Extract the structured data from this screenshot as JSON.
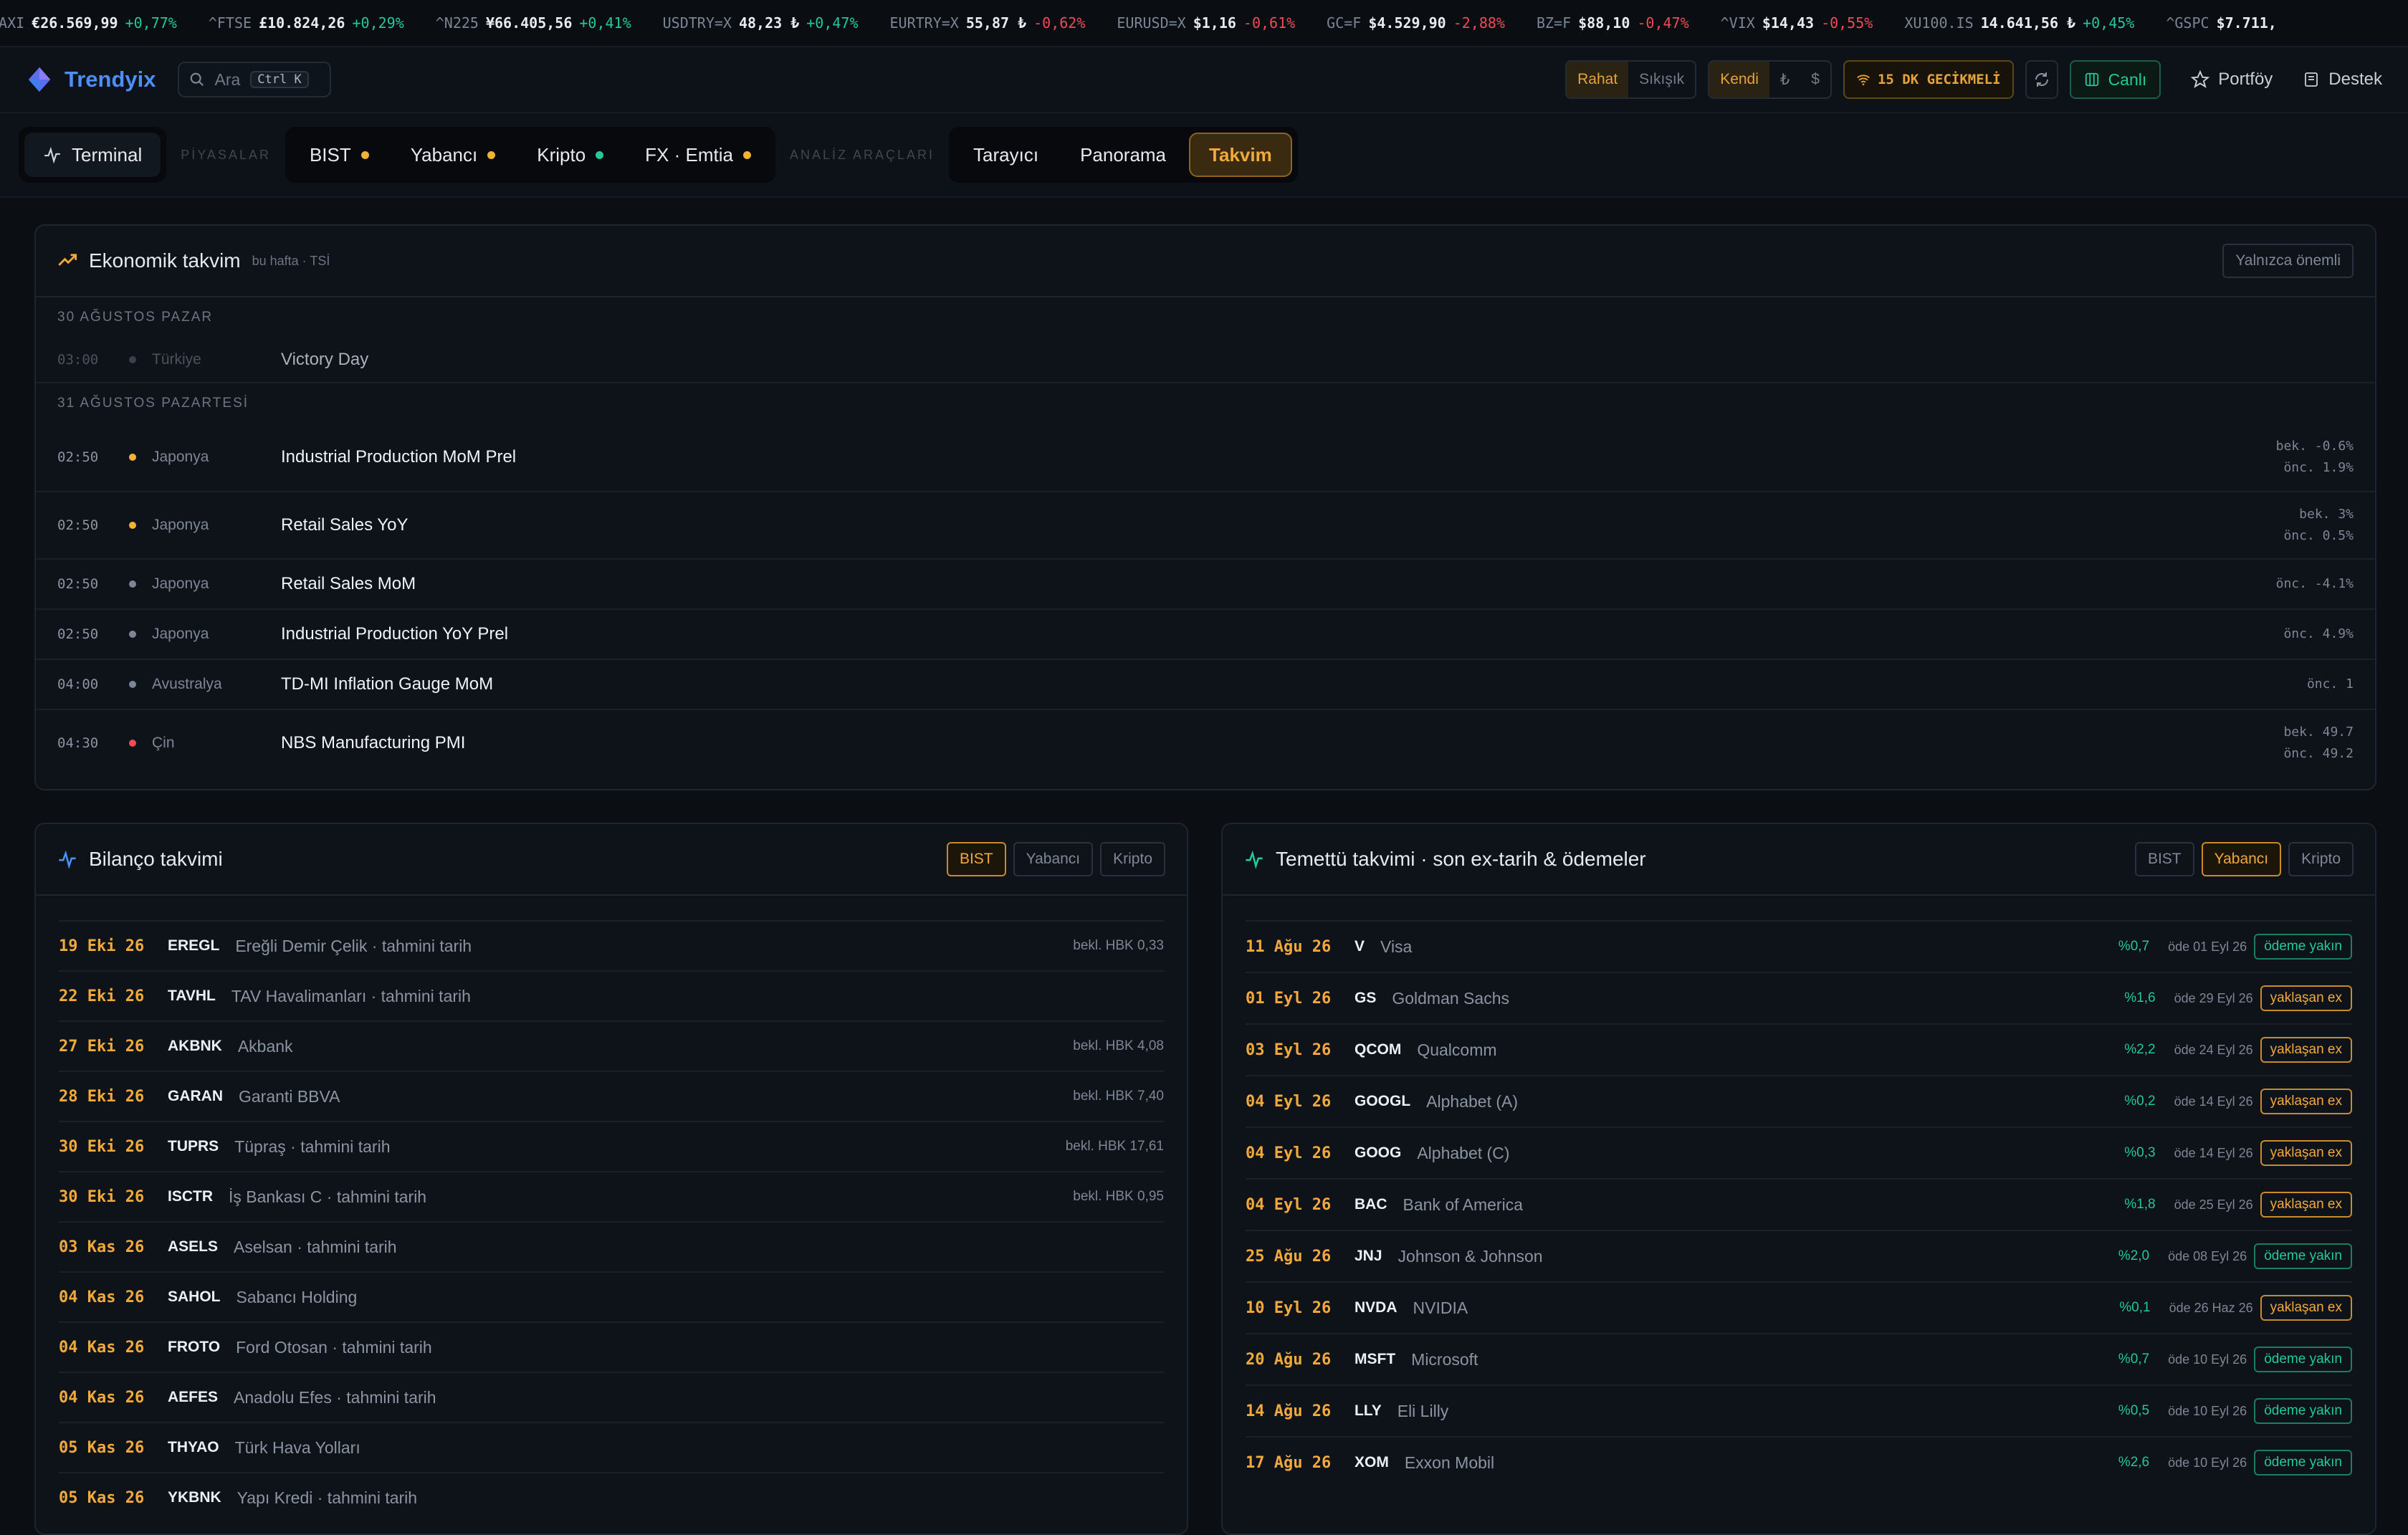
{
  "ticker": [
    {
      "sym": "DAXI",
      "price": "€26.569,99",
      "chg": "+0,77%",
      "dir": "up"
    },
    {
      "sym": "^FTSE",
      "price": "£10.824,26",
      "chg": "+0,29%",
      "dir": "up"
    },
    {
      "sym": "^N225",
      "price": "¥66.405,56",
      "chg": "+0,41%",
      "dir": "up"
    },
    {
      "sym": "USDTRY=X",
      "price": "48,23 ₺",
      "chg": "+0,47%",
      "dir": "up"
    },
    {
      "sym": "EURTRY=X",
      "price": "55,87 ₺",
      "chg": "-0,62%",
      "dir": "down"
    },
    {
      "sym": "EURUSD=X",
      "price": "$1,16",
      "chg": "-0,61%",
      "dir": "down"
    },
    {
      "sym": "GC=F",
      "price": "$4.529,90",
      "chg": "-2,88%",
      "dir": "down"
    },
    {
      "sym": "BZ=F",
      "price": "$88,10",
      "chg": "-0,47%",
      "dir": "down"
    },
    {
      "sym": "^VIX",
      "price": "$14,43",
      "chg": "-0,55%",
      "dir": "down"
    },
    {
      "sym": "XU100.IS",
      "price": "14.641,56 ₺",
      "chg": "+0,45%",
      "dir": "up"
    },
    {
      "sym": "^GSPC",
      "price": "$7.711,",
      "chg": "",
      "dir": "up"
    }
  ],
  "header": {
    "app_name": "Trendyix",
    "search_placeholder": "Ara",
    "search_shortcut": "Ctrl K",
    "density": [
      "Rahat",
      "Sıkışık"
    ],
    "currency": [
      "Kendi",
      "₺",
      "$"
    ],
    "delay_label": "15 DK GECİKMELİ",
    "live_label": "Canlı",
    "portfolio_label": "Portföy",
    "support_label": "Destek"
  },
  "nav": {
    "terminal": "Terminal",
    "markets_label": "PİYASALAR",
    "markets": [
      {
        "label": "BIST",
        "dot": "#f2b233"
      },
      {
        "label": "Yabancı",
        "dot": "#f2b233"
      },
      {
        "label": "Kripto",
        "dot": "#22c99a"
      },
      {
        "label": "FX · Emtia",
        "dot": "#f2b233"
      }
    ],
    "tools_label": "ANALİZ ARAÇLARI",
    "tools": [
      "Tarayıcı",
      "Panorama",
      "Takvim"
    ]
  },
  "econ": {
    "title": "Ekonomik takvim",
    "subtitle": "bu hafta · TSİ",
    "filter_button": "Yalnızca önemli",
    "day1": "30 AĞUSTOS PAZAR",
    "day1_events": [
      {
        "time": "03:00",
        "country": "Türkiye",
        "name": "Victory Day",
        "dot": "#3a414c"
      }
    ],
    "day2": "31 AĞUSTOS PAZARTESİ",
    "day2_events": [
      {
        "time": "02:50",
        "country": "Japonya",
        "name": "Industrial Production MoM Prel",
        "dot": "#f2b233",
        "exp": "bek. -0.6%",
        "prev": "önc. 1.9%"
      },
      {
        "time": "02:50",
        "country": "Japonya",
        "name": "Retail Sales YoY",
        "dot": "#f2b233",
        "exp": "bek. 3%",
        "prev": "önc. 0.5%"
      },
      {
        "time": "02:50",
        "country": "Japonya",
        "name": "Retail Sales MoM",
        "dot": "#7d8694",
        "exp": "",
        "prev": "önc. -4.1%"
      },
      {
        "time": "02:50",
        "country": "Japonya",
        "name": "Industrial Production YoY Prel",
        "dot": "#7d8694",
        "exp": "",
        "prev": "önc. 4.9%"
      },
      {
        "time": "04:00",
        "country": "Avustralya",
        "name": "TD-MI Inflation Gauge MoM",
        "dot": "#7d8694",
        "exp": "",
        "prev": "önc. 1"
      },
      {
        "time": "04:30",
        "country": "Çin",
        "name": "NBS Manufacturing PMI",
        "dot": "#ef4b57",
        "exp": "bek. 49.7",
        "prev": "önc. 49.2"
      }
    ]
  },
  "earnings": {
    "title": "Bilanço takvimi",
    "tabs": [
      "BIST",
      "Yabancı",
      "Kripto"
    ],
    "rows": [
      {
        "date": "19 Eki 26",
        "ticker": "EREGL",
        "name": "Ereğli Demir Çelik · tahmini tarih",
        "est": "bekl. HBK 0,33"
      },
      {
        "date": "22 Eki 26",
        "ticker": "TAVHL",
        "name": "TAV Havalimanları · tahmini tarih",
        "est": ""
      },
      {
        "date": "27 Eki 26",
        "ticker": "AKBNK",
        "name": "Akbank",
        "est": "bekl. HBK 4,08"
      },
      {
        "date": "28 Eki 26",
        "ticker": "GARAN",
        "name": "Garanti BBVA",
        "est": "bekl. HBK 7,40"
      },
      {
        "date": "30 Eki 26",
        "ticker": "TUPRS",
        "name": "Tüpraş · tahmini tarih",
        "est": "bekl. HBK 17,61"
      },
      {
        "date": "30 Eki 26",
        "ticker": "ISCTR",
        "name": "İş Bankası C · tahmini tarih",
        "est": "bekl. HBK 0,95"
      },
      {
        "date": "03 Kas 26",
        "ticker": "ASELS",
        "name": "Aselsan · tahmini tarih",
        "est": ""
      },
      {
        "date": "04 Kas 26",
        "ticker": "SAHOL",
        "name": "Sabancı Holding",
        "est": ""
      },
      {
        "date": "04 Kas 26",
        "ticker": "FROTO",
        "name": "Ford Otosan · tahmini tarih",
        "est": ""
      },
      {
        "date": "04 Kas 26",
        "ticker": "AEFES",
        "name": "Anadolu Efes · tahmini tarih",
        "est": ""
      },
      {
        "date": "05 Kas 26",
        "ticker": "THYAO",
        "name": "Türk Hava Yolları",
        "est": ""
      },
      {
        "date": "05 Kas 26",
        "ticker": "YKBNK",
        "name": "Yapı Kredi · tahmini tarih",
        "est": ""
      }
    ]
  },
  "dividends": {
    "title": "Temettü takvimi · son ex-tarih & ödemeler",
    "tabs": [
      "BIST",
      "Yabancı",
      "Kripto"
    ],
    "rows": [
      {
        "date": "11 Ağu 26",
        "ticker": "V",
        "name": "Visa",
        "yield": "%0,7",
        "pay": "öde 01 Eyl 26",
        "status": "ödeme yakın",
        "kind": "g"
      },
      {
        "date": "01 Eyl 26",
        "ticker": "GS",
        "name": "Goldman Sachs",
        "yield": "%1,6",
        "pay": "öde 29 Eyl 26",
        "status": "yaklaşan ex",
        "kind": "o"
      },
      {
        "date": "03 Eyl 26",
        "ticker": "QCOM",
        "name": "Qualcomm",
        "yield": "%2,2",
        "pay": "öde 24 Eyl 26",
        "status": "yaklaşan ex",
        "kind": "o"
      },
      {
        "date": "04 Eyl 26",
        "ticker": "GOOGL",
        "name": "Alphabet (A)",
        "yield": "%0,2",
        "pay": "öde 14 Eyl 26",
        "status": "yaklaşan ex",
        "kind": "o"
      },
      {
        "date": "04 Eyl 26",
        "ticker": "GOOG",
        "name": "Alphabet (C)",
        "yield": "%0,3",
        "pay": "öde 14 Eyl 26",
        "status": "yaklaşan ex",
        "kind": "o"
      },
      {
        "date": "04 Eyl 26",
        "ticker": "BAC",
        "name": "Bank of America",
        "yield": "%1,8",
        "pay": "öde 25 Eyl 26",
        "status": "yaklaşan ex",
        "kind": "o"
      },
      {
        "date": "25 Ağu 26",
        "ticker": "JNJ",
        "name": "Johnson & Johnson",
        "yield": "%2,0",
        "pay": "öde 08 Eyl 26",
        "status": "ödeme yakın",
        "kind": "g"
      },
      {
        "date": "10 Eyl 26",
        "ticker": "NVDA",
        "name": "NVIDIA",
        "yield": "%0,1",
        "pay": "öde 26 Haz 26",
        "status": "yaklaşan ex",
        "kind": "o"
      },
      {
        "date": "20 Ağu 26",
        "ticker": "MSFT",
        "name": "Microsoft",
        "yield": "%0,7",
        "pay": "öde 10 Eyl 26",
        "status": "ödeme yakın",
        "kind": "g"
      },
      {
        "date": "14 Ağu 26",
        "ticker": "LLY",
        "name": "Eli Lilly",
        "yield": "%0,5",
        "pay": "öde 10 Eyl 26",
        "status": "ödeme yakın",
        "kind": "g"
      },
      {
        "date": "17 Ağu 26",
        "ticker": "XOM",
        "name": "Exxon Mobil",
        "yield": "%2,6",
        "pay": "öde 10 Eyl 26",
        "status": "ödeme yakın",
        "kind": "g"
      }
    ]
  }
}
